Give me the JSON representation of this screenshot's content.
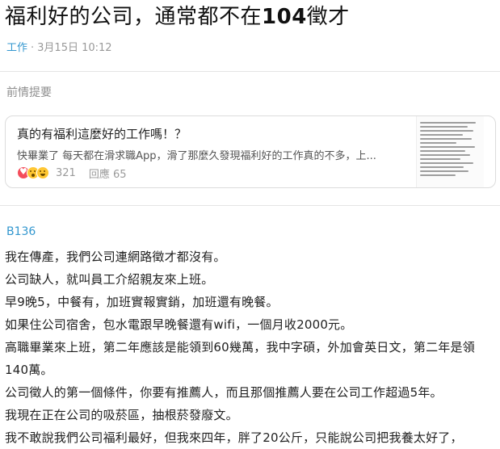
{
  "post": {
    "title_prefix": "福利好的公司，通常都不在",
    "title_number": "104",
    "title_suffix": "徵才",
    "board": "工作",
    "meta_separator": "·",
    "date": "3月15日 10:12"
  },
  "quoted": {
    "section_label": "前情提要",
    "title": "真的有福利這麼好的工作嗎！？",
    "excerpt": "快畢業了 每天都在滑求職App，滑了那麼久發現福利好的工作真的不多，上...",
    "reaction_icons": [
      "heart-reaction-icon",
      "wow-reaction-icon",
      "haha-reaction-icon"
    ],
    "like_count": "321",
    "reply_label": "回應 65"
  },
  "comment": {
    "floor": "B136",
    "lines": [
      "我在傳產，我們公司連網路徵才都沒有。",
      "公司缺人，就叫員工介紹親友來上班。",
      "早9晚5，中餐有，加班實報實銷，加班還有晚餐。",
      "如果住公司宿舍，包水電跟早晚餐還有wifi，一個月收2000元。",
      "高職畢業來上班，第二年應該是能領到60幾萬，我中字碩，外加會英日文，第二年是領140萬。",
      "公司徵人的第一個條件，你要有推薦人，而且那個推薦人要在公司工作超過5年。",
      "我現在正在公司的吸菸區，抽根菸發廢文。",
      "我不敢說我們公司福利最好，但我來四年，胖了20公斤，只能說公司把我養太好了，"
    ]
  },
  "colors": {
    "link": "#3397cf",
    "meta": "#999999",
    "text": "#212121",
    "divider": "#e5e5e5"
  }
}
